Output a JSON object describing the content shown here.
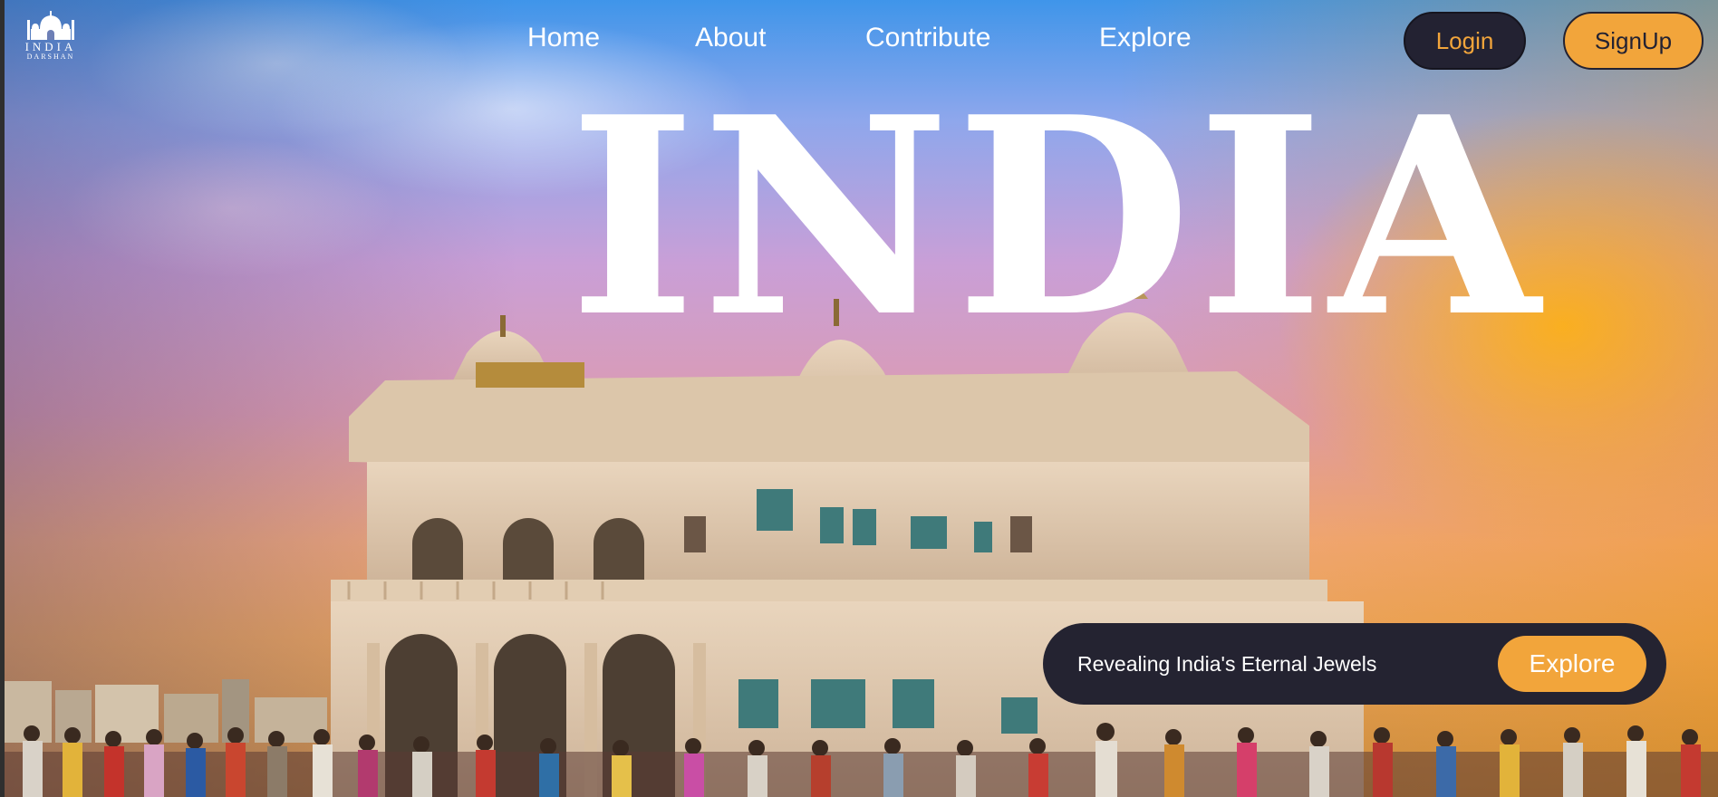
{
  "brand": {
    "logo_icon": "taj-mahal-icon",
    "line1": "INDIA",
    "line2": "DARSHAN"
  },
  "nav": {
    "items": [
      {
        "label": "Home"
      },
      {
        "label": "About"
      },
      {
        "label": "Contribute"
      },
      {
        "label": "Explore"
      }
    ]
  },
  "auth": {
    "login_label": "Login",
    "signup_label": "SignUp"
  },
  "hero": {
    "title": "INDIA",
    "tagline": "Revealing India's Eternal Jewels",
    "cta_label": "Explore"
  },
  "colors": {
    "accent": "#f2a53b",
    "dark": "#232232",
    "text_light": "#ffffff"
  }
}
